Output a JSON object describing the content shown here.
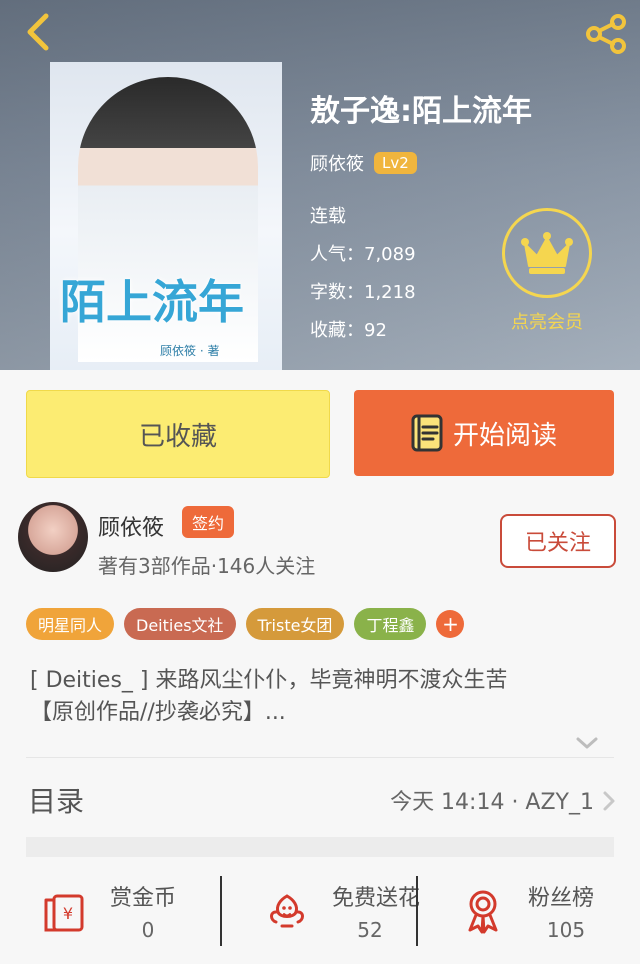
{
  "header": {
    "book_title": "敖子逸:陌上流年",
    "author_name": "顾依筱",
    "author_level": "Lv2",
    "status": "连载",
    "popularity": "人气：7,089",
    "word_count": "字数：1,218",
    "favorites": "收藏：92",
    "member_label": "点亮会员",
    "cover": {
      "art_title": "陌上流年",
      "art_small": "顾依筱 · 著"
    }
  },
  "actions": {
    "collected_label": "已收藏",
    "read_label": "开始阅读"
  },
  "author": {
    "name": "顾依筱",
    "badge": "签约",
    "subtitle": "著有3部作品·146人关注",
    "follow_label": "已关注"
  },
  "tags": [
    {
      "label": "明星同人",
      "color": "#f0a43a"
    },
    {
      "label": "Deities文社",
      "color": "#c96a52"
    },
    {
      "label": "Triste女团",
      "color": "#d59a3b"
    },
    {
      "label": "丁程鑫",
      "color": "#8ab24a"
    }
  ],
  "tag_plus": "+",
  "description": {
    "line1": "[ Deities_ ] 来路风尘仆仆，毕竟神明不渡众生苦",
    "line2": "【原创作品//抄袭必究】..."
  },
  "toc": {
    "title": "目录",
    "right": "今天 14:14 · AZY_1"
  },
  "bottom": [
    {
      "label": "赏金币",
      "value": "0"
    },
    {
      "label": "免费送花",
      "value": "52"
    },
    {
      "label": "粉丝榜",
      "value": "105"
    }
  ],
  "colors": {
    "accent": "#ee6a3a",
    "collect_bg": "#fcec72",
    "crown": "#f5d64f",
    "level": "#f0b53d"
  },
  "icons": {
    "back": "chevron-left-icon",
    "share": "share-icon",
    "crown": "crown-icon",
    "book": "book-icon",
    "coin": "coin-icon",
    "flower": "flower-icon",
    "fans": "ribbon-medal-icon",
    "toc_chevron": "chevron-right-icon",
    "expand": "chevron-down-icon"
  }
}
